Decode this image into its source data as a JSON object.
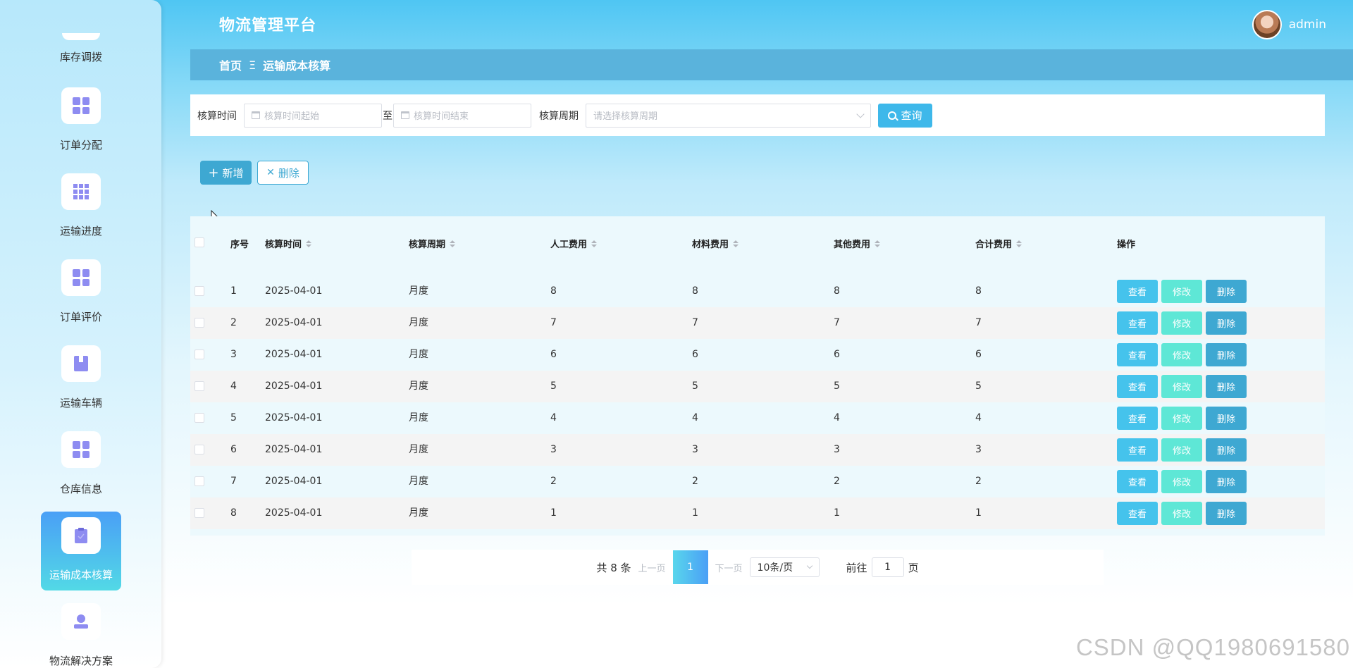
{
  "app": {
    "title": "物流管理平台",
    "username": "admin"
  },
  "sidebar": {
    "items": [
      {
        "label": "库存调拨",
        "icon": "partial-top-icon"
      },
      {
        "label": "订单分配",
        "icon": "grid-icon"
      },
      {
        "label": "运输进度",
        "icon": "table-grid-icon"
      },
      {
        "label": "订单评价",
        "icon": "grid-icon"
      },
      {
        "label": "运输车辆",
        "icon": "book-icon"
      },
      {
        "label": "仓库信息",
        "icon": "grid-icon"
      },
      {
        "label": "运输成本核算",
        "icon": "clipboard-icon",
        "active": true
      },
      {
        "label": "物流解决方案",
        "icon": "user-icon"
      }
    ]
  },
  "breadcrumb": {
    "home": "首页",
    "separator": "Ξ",
    "current": "运输成本核算"
  },
  "search": {
    "date_label": "核算时间",
    "start_placeholder": "核算时间起始",
    "to": "至",
    "end_placeholder": "核算时间结束",
    "period_label": "核算周期",
    "period_placeholder": "请选择核算周期",
    "query_label": "查询"
  },
  "actions": {
    "add_label": "新增",
    "delete_label": "删除"
  },
  "table": {
    "headers": {
      "index": "序号",
      "date": "核算时间",
      "period": "核算周期",
      "labor": "人工费用",
      "material": "材料费用",
      "other": "其他费用",
      "total": "合计费用",
      "ops": "操作"
    },
    "row_buttons": {
      "view": "查看",
      "edit": "修改",
      "remove": "删除"
    },
    "rows": [
      {
        "index": "1",
        "date": "2025-04-01",
        "period": "月度",
        "labor": "8",
        "material": "8",
        "other": "8",
        "total": "8"
      },
      {
        "index": "2",
        "date": "2025-04-01",
        "period": "月度",
        "labor": "7",
        "material": "7",
        "other": "7",
        "total": "7"
      },
      {
        "index": "3",
        "date": "2025-04-01",
        "period": "月度",
        "labor": "6",
        "material": "6",
        "other": "6",
        "total": "6"
      },
      {
        "index": "4",
        "date": "2025-04-01",
        "period": "月度",
        "labor": "5",
        "material": "5",
        "other": "5",
        "total": "5"
      },
      {
        "index": "5",
        "date": "2025-04-01",
        "period": "月度",
        "labor": "4",
        "material": "4",
        "other": "4",
        "total": "4"
      },
      {
        "index": "6",
        "date": "2025-04-01",
        "period": "月度",
        "labor": "3",
        "material": "3",
        "other": "3",
        "total": "3"
      },
      {
        "index": "7",
        "date": "2025-04-01",
        "period": "月度",
        "labor": "2",
        "material": "2",
        "other": "2",
        "total": "2"
      },
      {
        "index": "8",
        "date": "2025-04-01",
        "period": "月度",
        "labor": "1",
        "material": "1",
        "other": "1",
        "total": "1"
      }
    ]
  },
  "pagination": {
    "total_text": "共 8 条",
    "prev_label": "上一页",
    "current_page": "1",
    "next_label": "下一页",
    "page_size": "10条/页",
    "goto_label": "前往",
    "goto_value": "1",
    "page_suffix": "页"
  },
  "watermark": "CSDN @QQ1980691580",
  "colors": {
    "primary": "#3ea8d2",
    "view": "#45c3ec",
    "edit": "#5ee7d6",
    "icon": "#8e8cf1"
  }
}
